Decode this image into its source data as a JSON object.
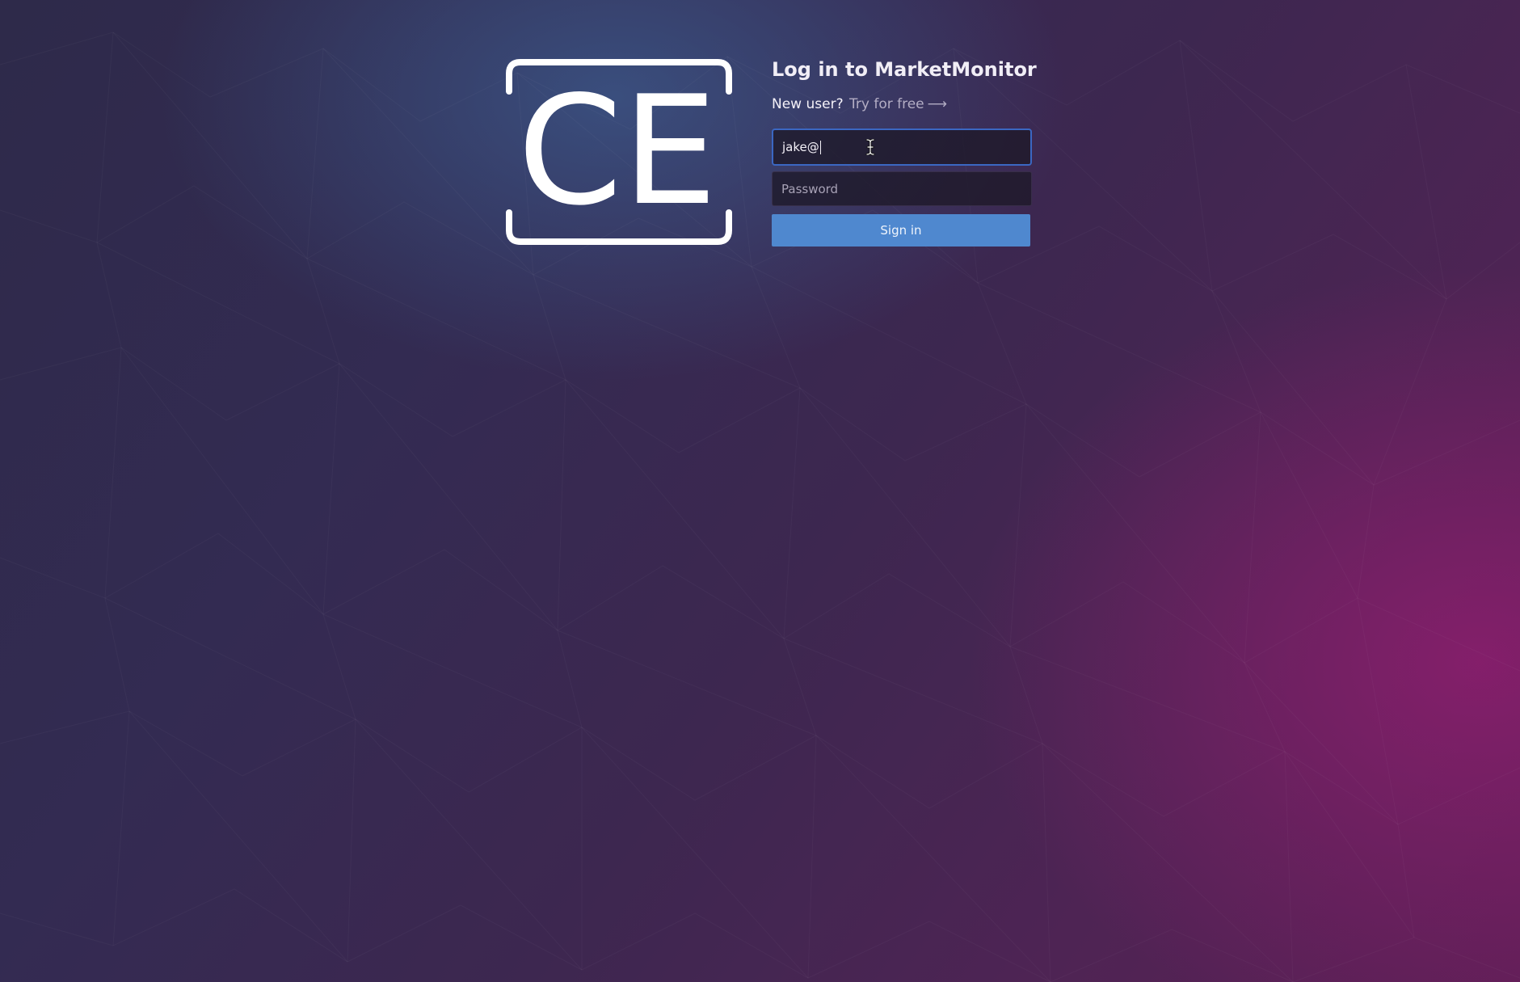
{
  "logo": {
    "icon": "ce-bracket-logo",
    "letters": "CE"
  },
  "login": {
    "title": "Log in to MarketMonitor",
    "signup_prompt": "New user?",
    "signup_link": "Try for free",
    "signup_arrow": "⟶",
    "email_value": "jake@",
    "password_placeholder": "Password",
    "signin_label": "Sign in"
  },
  "colors": {
    "accent": "#4f88cf",
    "focus_border": "#3b67c2"
  }
}
